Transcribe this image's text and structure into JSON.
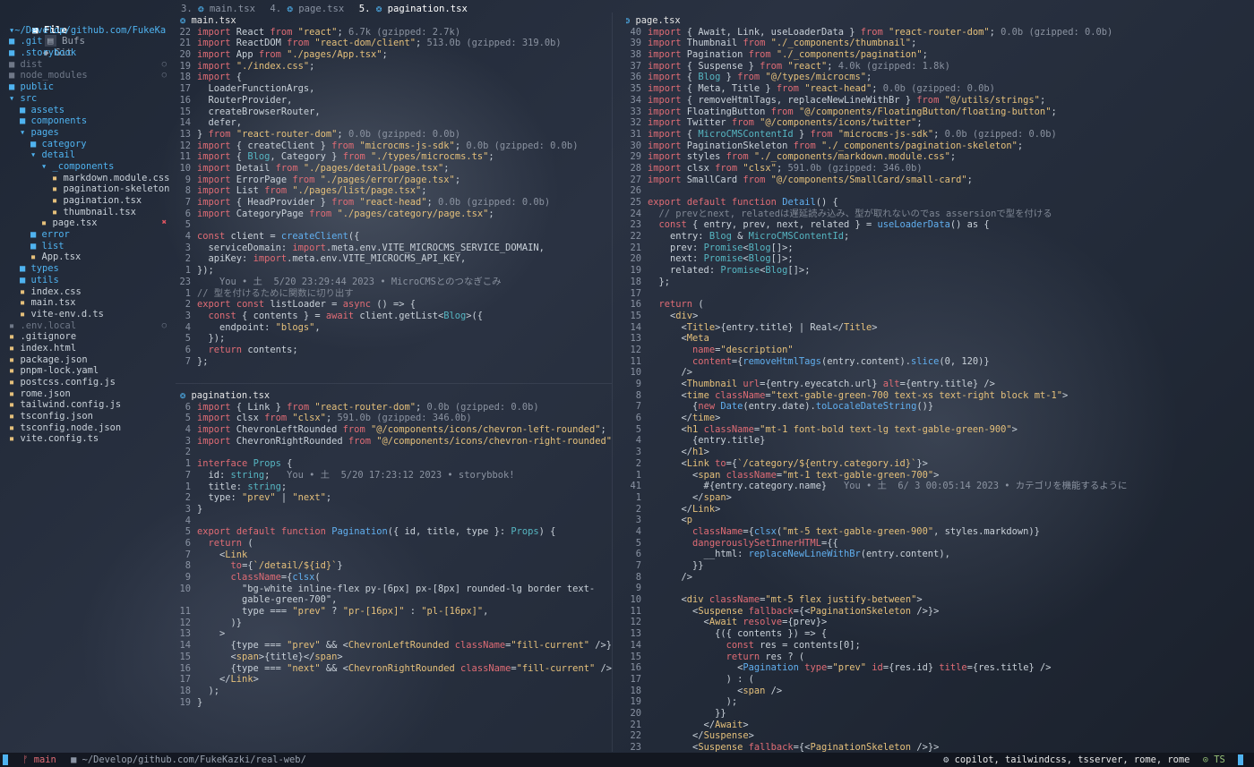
{
  "sidebar": {
    "tabs": [
      "File",
      "Bufs",
      "Git"
    ],
    "root": "~/Develop/github.com/FukeKa",
    "items": [
      {
        "d": 0,
        "name": ".git",
        "type": "folder"
      },
      {
        "d": 0,
        "name": ".storybook",
        "type": "folder"
      },
      {
        "d": 0,
        "name": "dist",
        "type": "folder-dim"
      },
      {
        "d": 0,
        "name": "node_modules",
        "type": "folder-dim"
      },
      {
        "d": 0,
        "name": "public",
        "type": "folder"
      },
      {
        "d": 0,
        "name": "src",
        "type": "folder-open"
      },
      {
        "d": 1,
        "name": "assets",
        "type": "folder"
      },
      {
        "d": 1,
        "name": "components",
        "type": "folder"
      },
      {
        "d": 1,
        "name": "pages",
        "type": "folder-open"
      },
      {
        "d": 2,
        "name": "category",
        "type": "folder"
      },
      {
        "d": 2,
        "name": "detail",
        "type": "folder-open"
      },
      {
        "d": 3,
        "name": "_components",
        "type": "folder-open"
      },
      {
        "d": 4,
        "name": "markdown.module.css",
        "type": "file"
      },
      {
        "d": 4,
        "name": "pagination-skeleton",
        "type": "file"
      },
      {
        "d": 4,
        "name": "pagination.tsx",
        "type": "file"
      },
      {
        "d": 4,
        "name": "thumbnail.tsx",
        "type": "file"
      },
      {
        "d": 3,
        "name": "page.tsx",
        "type": "file"
      },
      {
        "d": 2,
        "name": "error",
        "type": "folder"
      },
      {
        "d": 2,
        "name": "list",
        "type": "folder"
      },
      {
        "d": 2,
        "name": "App.tsx",
        "type": "file"
      },
      {
        "d": 1,
        "name": "types",
        "type": "folder"
      },
      {
        "d": 1,
        "name": "utils",
        "type": "folder"
      },
      {
        "d": 1,
        "name": "index.css",
        "type": "file"
      },
      {
        "d": 1,
        "name": "main.tsx",
        "type": "file"
      },
      {
        "d": 1,
        "name": "vite-env.d.ts",
        "type": "file"
      },
      {
        "d": 0,
        "name": ".env.local",
        "type": "file-dim"
      },
      {
        "d": 0,
        "name": ".gitignore",
        "type": "file"
      },
      {
        "d": 0,
        "name": "index.html",
        "type": "file"
      },
      {
        "d": 0,
        "name": "package.json",
        "type": "file"
      },
      {
        "d": 0,
        "name": "pnpm-lock.yaml",
        "type": "file"
      },
      {
        "d": 0,
        "name": "postcss.config.js",
        "type": "file"
      },
      {
        "d": 0,
        "name": "rome.json",
        "type": "file"
      },
      {
        "d": 0,
        "name": "tailwind.config.js",
        "type": "file"
      },
      {
        "d": 0,
        "name": "tsconfig.json",
        "type": "file"
      },
      {
        "d": 0,
        "name": "tsconfig.node.json",
        "type": "file"
      },
      {
        "d": 0,
        "name": "vite.config.ts",
        "type": "file"
      }
    ]
  },
  "tabs": {
    "items": [
      "3. main.tsx",
      "4. page.tsx",
      "5. pagination.tsx"
    ]
  },
  "panes": {
    "main": {
      "filename": "main.tsx",
      "lines": [
        [
          "22",
          "import React from \"react\"; 6.7k (gzipped: 2.7k)"
        ],
        [
          "21",
          "import ReactDOM from \"react-dom/client\"; 513.0b (gzipped: 319.0b)"
        ],
        [
          "20",
          "import App from \"./pages/App.tsx\";"
        ],
        [
          "19",
          "import \"./index.css\";"
        ],
        [
          "18",
          "import {"
        ],
        [
          "17",
          "  LoaderFunctionArgs,"
        ],
        [
          "16",
          "  RouterProvider,"
        ],
        [
          "15",
          "  createBrowserRouter,"
        ],
        [
          "14",
          "  defer,"
        ],
        [
          "13",
          "} from \"react-router-dom\"; 0.0b (gzipped: 0.0b)"
        ],
        [
          "12",
          "import { createClient } from \"microcms-js-sdk\"; 0.0b (gzipped: 0.0b)"
        ],
        [
          "11",
          "import { Blog, Category } from \"./types/microcms.ts\";"
        ],
        [
          "10",
          "import Detail from \"./pages/detail/page.tsx\";"
        ],
        [
          "9",
          "import ErrorPage from \"./pages/error/page.tsx\";"
        ],
        [
          "8",
          "import List from \"./pages/list/page.tsx\";"
        ],
        [
          "7",
          "import { HeadProvider } from \"react-head\"; 0.0b (gzipped: 0.0b)"
        ],
        [
          "6",
          "import CategoryPage from \"./pages/category/page.tsx\";"
        ],
        [
          "5",
          ""
        ],
        [
          "4",
          "const client = createClient({"
        ],
        [
          "3",
          "  serviceDomain: import.meta.env.VITE_MICROCMS_SERVICE_DOMAIN,"
        ],
        [
          "2",
          "  apiKey: import.meta.env.VITE_MICROCMS_API_KEY,"
        ],
        [
          "1",
          "});"
        ],
        [
          "23",
          "    You • 土  5/20 23:29:44 2023 • MicroCMSとのつなぎこみ"
        ],
        [
          "1",
          "// 型を付けるために関数に切り出す"
        ],
        [
          "2",
          "export const listLoader = async () => {"
        ],
        [
          "3",
          "  const { contents } = await client.getList<Blog>({"
        ],
        [
          "4",
          "    endpoint: \"blogs\","
        ],
        [
          "5",
          "  });"
        ],
        [
          "6",
          "  return contents;"
        ],
        [
          "7",
          "};"
        ]
      ]
    },
    "pagination": {
      "filename": "pagination.tsx",
      "lines": [
        [
          "6",
          "import { Link } from \"react-router-dom\"; 0.0b (gzipped: 0.0b)"
        ],
        [
          "5",
          "import clsx from \"clsx\"; 591.0b (gzipped: 346.0b)"
        ],
        [
          "4",
          "import ChevronLeftRounded from \"@/components/icons/chevron-left-rounded\";"
        ],
        [
          "3",
          "import ChevronRightRounded from \"@/components/icons/chevron-right-rounded\";"
        ],
        [
          "2",
          ""
        ],
        [
          "1",
          "interface Props {"
        ],
        [
          "7",
          "  id: string;   You • 土  5/20 17:23:12 2023 • storybbok!"
        ],
        [
          "1",
          "  title: string;"
        ],
        [
          "2",
          "  type: \"prev\" | \"next\";"
        ],
        [
          "3",
          "}"
        ],
        [
          "4",
          ""
        ],
        [
          "5",
          "export default function Pagination({ id, title, type }: Props) {"
        ],
        [
          "6",
          "  return ("
        ],
        [
          "7",
          "    <Link"
        ],
        [
          "8",
          "      to={`/detail/${id}`}"
        ],
        [
          "9",
          "      className={clsx("
        ],
        [
          "10",
          "        \"bg-white inline-flex py-[6px] px-[8px] rounded-lg border text-"
        ],
        [
          "",
          "        gable-green-700\","
        ],
        [
          "11",
          "        type === \"prev\" ? \"pr-[16px]\" : \"pl-[16px]\","
        ],
        [
          "12",
          "      )}"
        ],
        [
          "13",
          "    >"
        ],
        [
          "14",
          "      {type === \"prev\" && <ChevronLeftRounded className=\"fill-current\" />}"
        ],
        [
          "15",
          "      <span>{title}</span>"
        ],
        [
          "16",
          "      {type === \"next\" && <ChevronRightRounded className=\"fill-current\" />}"
        ],
        [
          "17",
          "    </Link>"
        ],
        [
          "18",
          "  );"
        ],
        [
          "19",
          "}"
        ]
      ]
    },
    "page": {
      "filename": "page.tsx",
      "lines": [
        [
          "40",
          "import { Await, Link, useLoaderData } from \"react-router-dom\"; 0.0b (gzipped: 0.0b)"
        ],
        [
          "39",
          "import Thumbnail from \"./_components/thumbnail\";"
        ],
        [
          "38",
          "import Pagination from \"./_components/pagination\";"
        ],
        [
          "37",
          "import { Suspense } from \"react\"; 4.0k (gzipped: 1.8k)"
        ],
        [
          "36",
          "import { Blog } from \"@/types/microcms\";"
        ],
        [
          "35",
          "import { Meta, Title } from \"react-head\"; 0.0b (gzipped: 0.0b)"
        ],
        [
          "34",
          "import { removeHtmlTags, replaceNewLineWithBr } from \"@/utils/strings\";"
        ],
        [
          "33",
          "import FloatingButton from \"@/components/FloatingButton/floating-button\";"
        ],
        [
          "32",
          "import Twitter from \"@/components/icons/twitter\";"
        ],
        [
          "31",
          "import { MicroCMSContentId } from \"microcms-js-sdk\"; 0.0b (gzipped: 0.0b)"
        ],
        [
          "30",
          "import PaginationSkeleton from \"./_components/pagination-skeleton\";"
        ],
        [
          "29",
          "import styles from \"./_components/markdown.module.css\";"
        ],
        [
          "28",
          "import clsx from \"clsx\"; 591.0b (gzipped: 346.0b)"
        ],
        [
          "27",
          "import SmallCard from \"@/components/SmallCard/small-card\";"
        ],
        [
          "26",
          ""
        ],
        [
          "25",
          "export default function Detail() {"
        ],
        [
          "24",
          "  // prevとnext, relatedは遅延読み込み、型が取れないのでas assersionで型を付ける"
        ],
        [
          "23",
          "  const { entry, prev, next, related } = useLoaderData() as {"
        ],
        [
          "22",
          "    entry: Blog & MicroCMSContentId;"
        ],
        [
          "21",
          "    prev: Promise<Blog[]>;"
        ],
        [
          "20",
          "    next: Promise<Blog[]>;"
        ],
        [
          "19",
          "    related: Promise<Blog[]>;"
        ],
        [
          "18",
          "  };"
        ],
        [
          "17",
          ""
        ],
        [
          "16",
          "  return ("
        ],
        [
          "15",
          "    <div>"
        ],
        [
          "14",
          "      <Title>{entry.title} | Real</Title>"
        ],
        [
          "13",
          "      <Meta"
        ],
        [
          "12",
          "        name=\"description\""
        ],
        [
          "11",
          "        content={removeHtmlTags(entry.content).slice(0, 120)}"
        ],
        [
          "10",
          "      />"
        ],
        [
          "9",
          "      <Thumbnail url={entry.eyecatch.url} alt={entry.title} />"
        ],
        [
          "8",
          "      <time className=\"text-gable-green-700 text-xs text-right block mt-1\">"
        ],
        [
          "7",
          "        {new Date(entry.date).toLocaleDateString()}"
        ],
        [
          "6",
          "      </time>"
        ],
        [
          "5",
          "      <h1 className=\"mt-1 font-bold text-lg text-gable-green-900\">"
        ],
        [
          "4",
          "        {entry.title}"
        ],
        [
          "3",
          "      </h1>"
        ],
        [
          "2",
          "      <Link to={`/category/${entry.category.id}`}>"
        ],
        [
          "1",
          "        <span className=\"mt-1 text-gable-green-700\">"
        ],
        [
          "41",
          "          #{entry.category.name}   You • 土  6/ 3 00:05:14 2023 • カテゴリを機能するように"
        ],
        [
          "1",
          "        </span>"
        ],
        [
          "2",
          "      </Link>"
        ],
        [
          "3",
          "      <p"
        ],
        [
          "4",
          "        className={clsx(\"mt-5 text-gable-green-900\", styles.markdown)}"
        ],
        [
          "5",
          "        dangerouslySetInnerHTML={{"
        ],
        [
          "6",
          "          __html: replaceNewLineWithBr(entry.content),"
        ],
        [
          "7",
          "        }}"
        ],
        [
          "8",
          "      />"
        ],
        [
          "9",
          ""
        ],
        [
          "10",
          "      <div className=\"mt-5 flex justify-between\">"
        ],
        [
          "11",
          "        <Suspense fallback={<PaginationSkeleton />}>"
        ],
        [
          "12",
          "          <Await resolve={prev}>"
        ],
        [
          "13",
          "            {({ contents }) => {"
        ],
        [
          "14",
          "              const res = contents[0];"
        ],
        [
          "15",
          "              return res ? ("
        ],
        [
          "16",
          "                <Pagination type=\"prev\" id={res.id} title={res.title} />"
        ],
        [
          "17",
          "              ) : ("
        ],
        [
          "18",
          "                <span />"
        ],
        [
          "19",
          "              );"
        ],
        [
          "20",
          "            }}"
        ],
        [
          "21",
          "          </Await>"
        ],
        [
          "22",
          "        </Suspense>"
        ],
        [
          "23",
          "        <Suspense fallback={<PaginationSkeleton />}>"
        ]
      ]
    }
  },
  "statusbar": {
    "branch": "main",
    "path": "~/Develop/github.com/FukeKazki/real-web/",
    "lsp": "copilot, tailwindcss, tsserver, rome, rome",
    "filetype": "TS"
  },
  "colors": {
    "accent": "#4fb3f0",
    "keyword": "#e06c75",
    "string": "#e5c07b",
    "error": "#e05561"
  }
}
